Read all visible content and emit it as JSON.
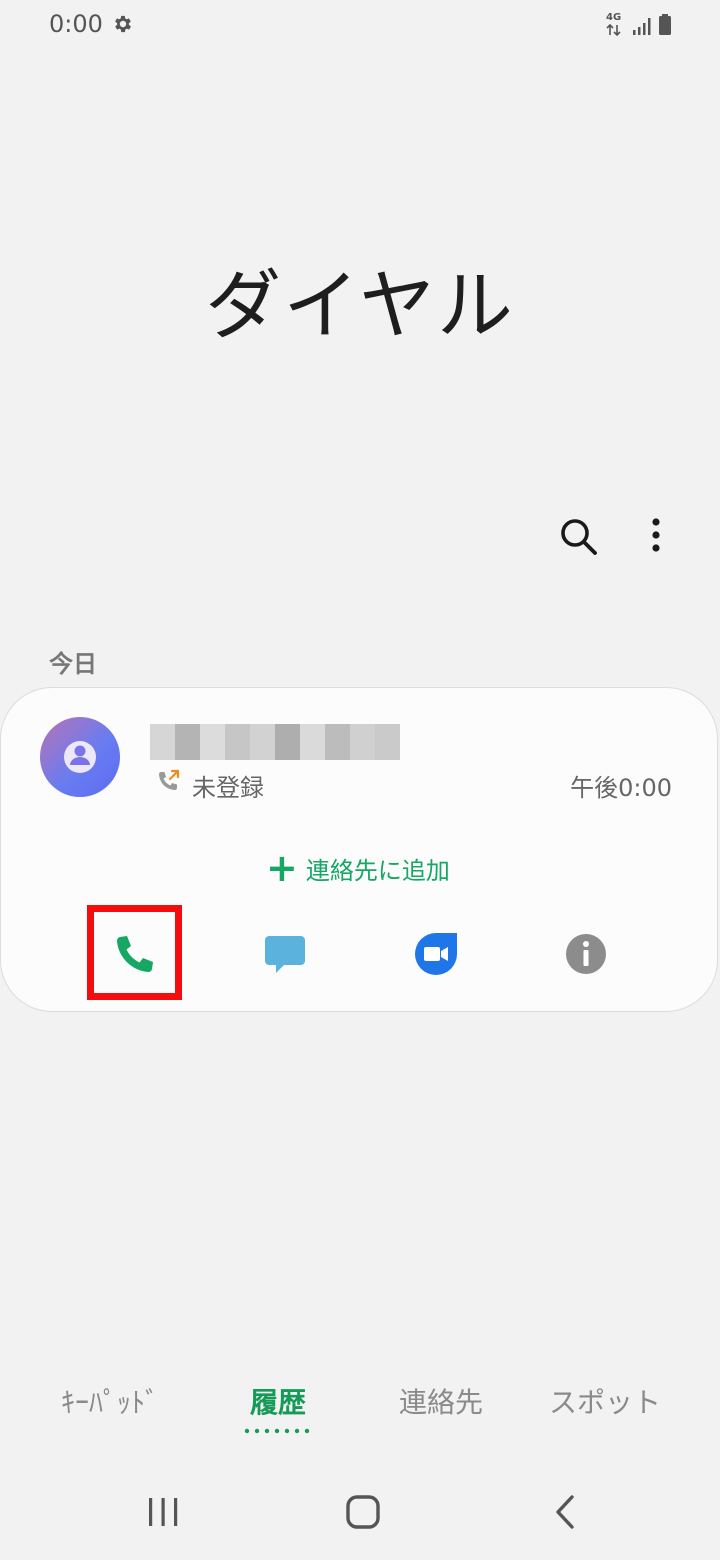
{
  "status_bar": {
    "time": "0:00",
    "settings_icon": "gear-icon",
    "network": "4G",
    "signal_icon": "signal-icon",
    "battery_icon": "battery-icon"
  },
  "title": "ダイヤル",
  "toolbar": {
    "search_icon": "search-icon",
    "more_icon": "more-vertical-icon"
  },
  "section": {
    "today": "今日"
  },
  "call_log": [
    {
      "name": "",
      "call_type_icon": "outgoing-call-icon",
      "label": "未登録",
      "time": "午後0:00"
    }
  ],
  "card_actions": {
    "add_contact": "連絡先に追加",
    "call_icon": "phone-icon",
    "message_icon": "message-icon",
    "video_icon": "video-call-icon",
    "info_icon": "info-icon"
  },
  "colors": {
    "accent_green": "#17a765",
    "message_blue": "#5bb3dd",
    "video_blue": "#1f76e8",
    "highlight_red": "#f50c0c"
  },
  "tabs": [
    {
      "label": "ｷｰﾊﾟｯﾄﾞ",
      "active": false
    },
    {
      "label": "履歴",
      "active": true
    },
    {
      "label": "連絡先",
      "active": false
    },
    {
      "label": "スポット",
      "active": false
    }
  ],
  "nav": {
    "recent_icon": "recent-apps-icon",
    "home_icon": "home-icon",
    "back_icon": "back-icon"
  }
}
